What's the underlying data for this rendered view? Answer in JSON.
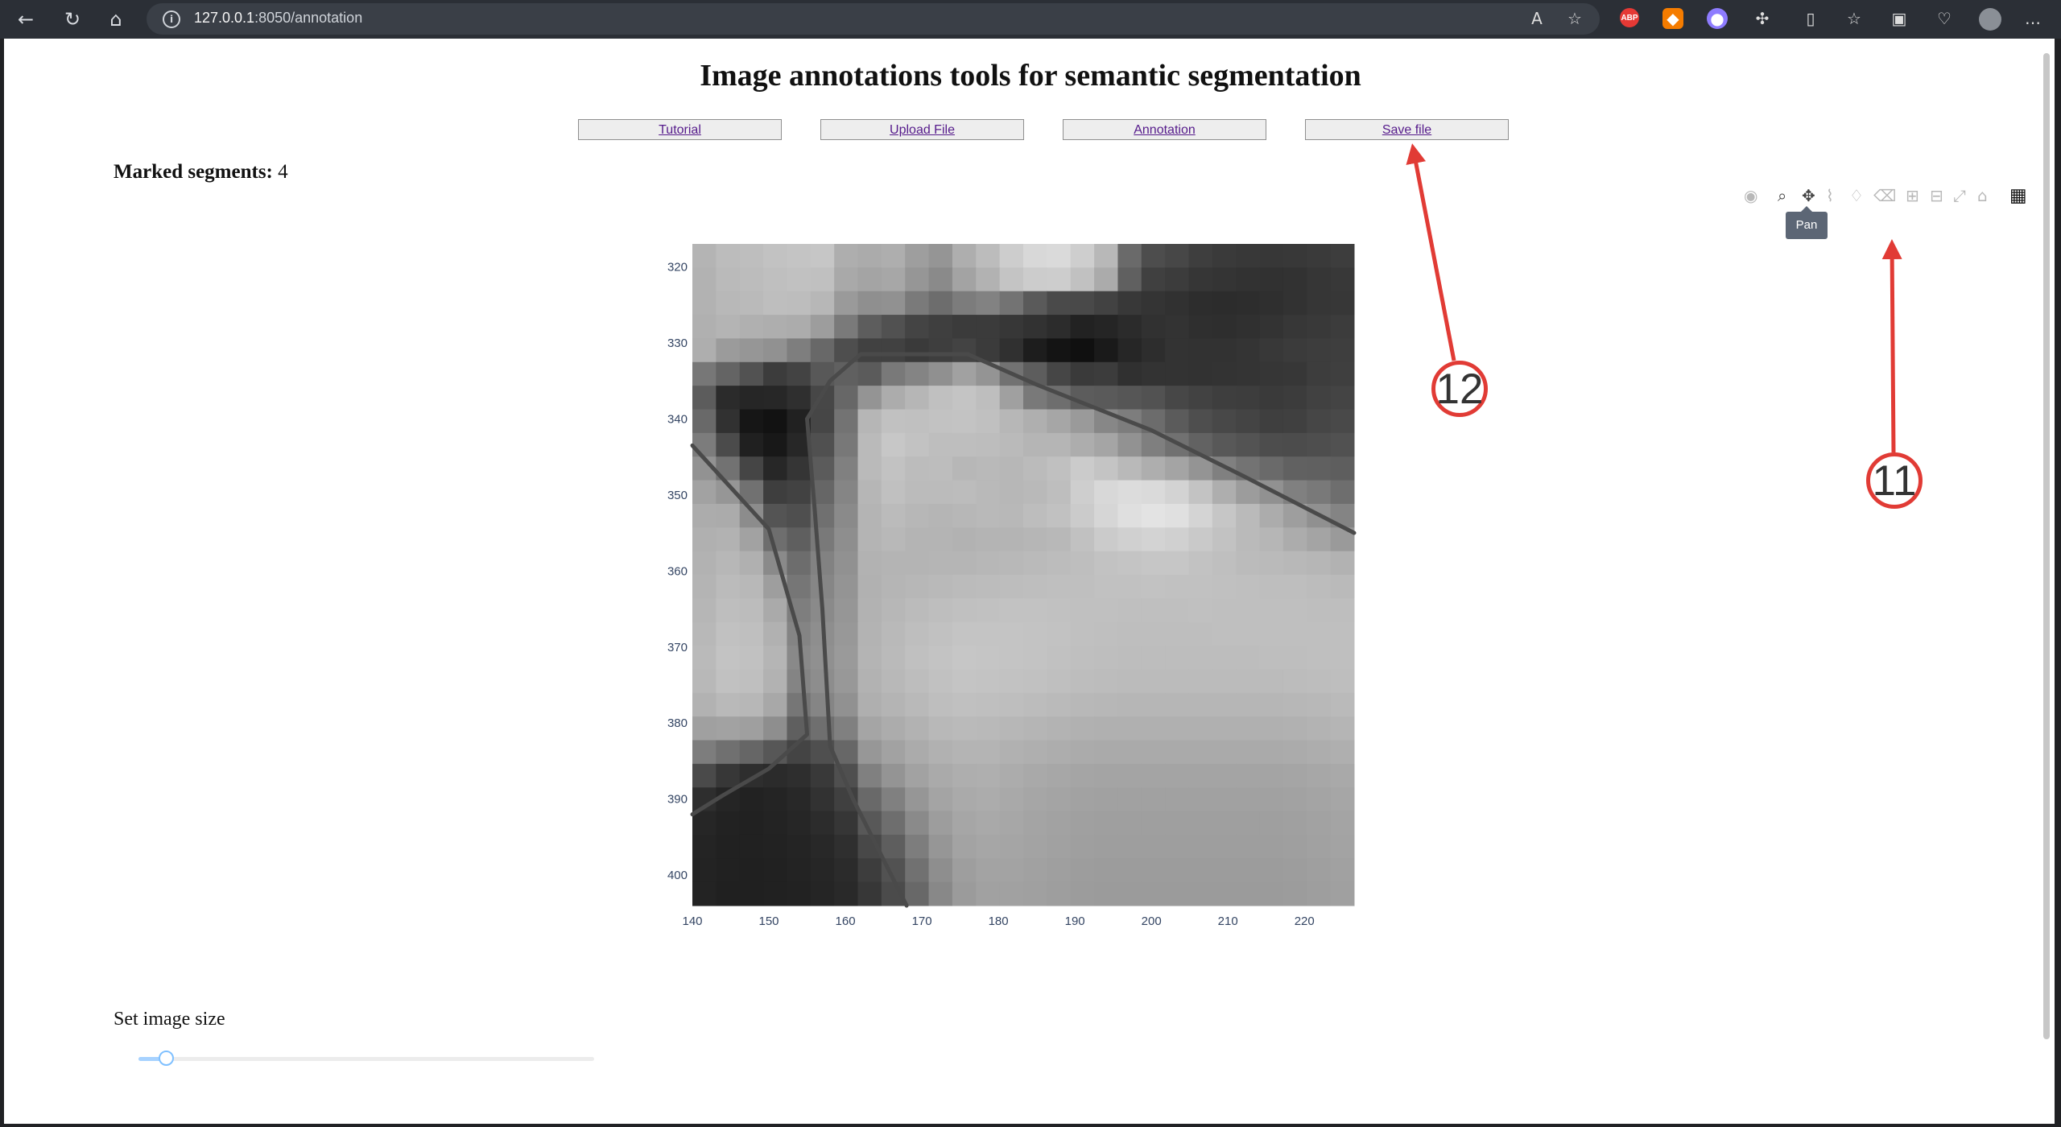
{
  "browser": {
    "url_prefix": "127.0.0.1",
    "url_suffix": ":8050/annotation",
    "icons": [
      "back-arrow-icon",
      "refresh-icon",
      "home-icon",
      "info-icon",
      "read-aloud-icon",
      "favorite-star-icon",
      "abp-extension-icon",
      "fox-extension-icon",
      "purple-extension-icon",
      "puzzle-extension-icon",
      "split-screen-icon",
      "favorites-icon",
      "collections-icon",
      "copilot-heart-icon",
      "profile-avatar-icon",
      "more-icon"
    ],
    "abp_label": "ABP"
  },
  "page": {
    "title": "Image annotations tools for semantic segmentation",
    "buttons": [
      "Tutorial",
      "Upload File",
      "Annotation",
      "Save file"
    ],
    "marked_segments_label": "Marked segments:",
    "marked_segments_value": "4",
    "tooltip": "Pan",
    "slider_label": "Set image size",
    "slider_fraction": 0.06
  },
  "chart_data": {
    "type": "heatmap",
    "x_ticks": [
      140,
      150,
      160,
      170,
      180,
      190,
      200,
      210,
      220
    ],
    "y_ticks": [
      320,
      330,
      340,
      350,
      360,
      370,
      380,
      390,
      400
    ],
    "x_range": [
      140,
      226.5
    ],
    "y_range": [
      317,
      404
    ],
    "pixels": [
      [
        180,
        188,
        190,
        194,
        196,
        198,
        174,
        171,
        174,
        158,
        149,
        174,
        188,
        205,
        216,
        218,
        206,
        184,
        106,
        77,
        71,
        62,
        58,
        56,
        55,
        56,
        58,
        61
      ],
      [
        178,
        186,
        188,
        191,
        193,
        192,
        169,
        164,
        167,
        150,
        138,
        163,
        178,
        196,
        204,
        205,
        193,
        171,
        96,
        64,
        60,
        54,
        52,
        50,
        49,
        50,
        54,
        56
      ],
      [
        178,
        184,
        186,
        190,
        189,
        183,
        154,
        143,
        145,
        122,
        109,
        124,
        130,
        115,
        90,
        74,
        73,
        66,
        56,
        52,
        49,
        45,
        44,
        45,
        47,
        50,
        54,
        55
      ],
      [
        176,
        180,
        176,
        174,
        172,
        157,
        122,
        93,
        81,
        68,
        63,
        59,
        59,
        55,
        50,
        44,
        34,
        37,
        43,
        49,
        51,
        47,
        46,
        48,
        51,
        55,
        57,
        60
      ],
      [
        174,
        155,
        150,
        145,
        126,
        104,
        78,
        65,
        65,
        58,
        62,
        67,
        59,
        48,
        29,
        20,
        16,
        26,
        38,
        45,
        51,
        50,
        50,
        52,
        56,
        59,
        61,
        62
      ],
      [
        119,
        100,
        82,
        60,
        67,
        88,
        96,
        91,
        121,
        132,
        144,
        161,
        148,
        114,
        93,
        70,
        58,
        60,
        48,
        51,
        51,
        50,
        51,
        52,
        54,
        55,
        61,
        63
      ],
      [
        92,
        43,
        38,
        39,
        47,
        71,
        103,
        148,
        172,
        182,
        192,
        196,
        190,
        160,
        121,
        110,
        92,
        90,
        86,
        82,
        71,
        66,
        62,
        61,
        58,
        60,
        65,
        68
      ],
      [
        105,
        49,
        22,
        18,
        33,
        70,
        115,
        182,
        193,
        192,
        194,
        195,
        192,
        183,
        175,
        166,
        154,
        135,
        125,
        108,
        91,
        78,
        72,
        68,
        63,
        64,
        70,
        73
      ],
      [
        124,
        75,
        32,
        24,
        39,
        80,
        120,
        186,
        199,
        194,
        190,
        190,
        189,
        186,
        181,
        181,
        173,
        165,
        146,
        127,
        113,
        98,
        88,
        83,
        77,
        76,
        78,
        81
      ],
      [
        146,
        114,
        69,
        39,
        53,
        91,
        128,
        186,
        194,
        188,
        189,
        183,
        185,
        183,
        187,
        192,
        203,
        196,
        185,
        174,
        164,
        148,
        128,
        115,
        106,
        97,
        96,
        94
      ],
      [
        162,
        150,
        113,
        62,
        66,
        102,
        133,
        182,
        192,
        187,
        187,
        188,
        185,
        183,
        185,
        190,
        206,
        216,
        220,
        218,
        211,
        195,
        174,
        156,
        145,
        128,
        121,
        110
      ],
      [
        172,
        171,
        140,
        84,
        79,
        112,
        138,
        180,
        187,
        183,
        181,
        183,
        185,
        184,
        189,
        193,
        203,
        214,
        223,
        227,
        224,
        212,
        198,
        186,
        172,
        158,
        144,
        132
      ],
      [
        176,
        178,
        162,
        110,
        95,
        121,
        142,
        180,
        184,
        180,
        180,
        178,
        180,
        180,
        182,
        184,
        193,
        203,
        208,
        211,
        208,
        201,
        194,
        186,
        182,
        172,
        164,
        154
      ],
      [
        178,
        183,
        176,
        138,
        109,
        130,
        145,
        178,
        180,
        180,
        181,
        181,
        183,
        184,
        186,
        188,
        190,
        194,
        196,
        198,
        198,
        194,
        191,
        187,
        186,
        184,
        182,
        178
      ],
      [
        180,
        187,
        184,
        158,
        118,
        134,
        148,
        177,
        181,
        183,
        185,
        187,
        188,
        189,
        190,
        191,
        191,
        193,
        193,
        194,
        193,
        193,
        192,
        191,
        190,
        190,
        188,
        186
      ],
      [
        182,
        190,
        188,
        170,
        126,
        138,
        150,
        178,
        183,
        187,
        190,
        192,
        193,
        194,
        194,
        193,
        192,
        192,
        191,
        191,
        191,
        192,
        191,
        191,
        191,
        191,
        190,
        190
      ],
      [
        184,
        193,
        191,
        177,
        132,
        142,
        152,
        179,
        185,
        190,
        193,
        196,
        196,
        196,
        195,
        194,
        192,
        191,
        190,
        190,
        190,
        190,
        191,
        191,
        191,
        191,
        191,
        191
      ],
      [
        186,
        195,
        193,
        181,
        137,
        144,
        154,
        180,
        186,
        192,
        195,
        198,
        197,
        196,
        195,
        193,
        191,
        190,
        189,
        189,
        189,
        189,
        189,
        189,
        190,
        190,
        191,
        191
      ],
      [
        184,
        193,
        191,
        178,
        132,
        141,
        152,
        178,
        184,
        189,
        193,
        196,
        195,
        194,
        193,
        191,
        189,
        188,
        187,
        187,
        187,
        187,
        187,
        187,
        187,
        188,
        189,
        190
      ],
      [
        178,
        185,
        183,
        168,
        118,
        133,
        145,
        175,
        180,
        185,
        190,
        192,
        191,
        190,
        188,
        186,
        184,
        183,
        182,
        182,
        182,
        182,
        182,
        182,
        182,
        183,
        184,
        186
      ],
      [
        160,
        162,
        159,
        142,
        95,
        111,
        128,
        165,
        172,
        178,
        184,
        186,
        185,
        183,
        181,
        179,
        177,
        176,
        176,
        176,
        176,
        176,
        176,
        176,
        176,
        177,
        179,
        181
      ],
      [
        125,
        112,
        102,
        87,
        68,
        79,
        103,
        151,
        162,
        171,
        177,
        180,
        180,
        177,
        175,
        173,
        171,
        170,
        170,
        170,
        170,
        170,
        170,
        170,
        170,
        171,
        173,
        175
      ],
      [
        74,
        55,
        46,
        43,
        46,
        57,
        79,
        128,
        148,
        162,
        170,
        174,
        175,
        172,
        169,
        167,
        165,
        164,
        164,
        164,
        164,
        164,
        164,
        164,
        164,
        165,
        167,
        169
      ],
      [
        46,
        37,
        34,
        36,
        40,
        50,
        64,
        105,
        128,
        150,
        164,
        170,
        172,
        169,
        166,
        164,
        162,
        161,
        161,
        161,
        161,
        161,
        161,
        161,
        161,
        162,
        164,
        166
      ],
      [
        38,
        34,
        33,
        35,
        38,
        44,
        54,
        88,
        110,
        138,
        157,
        166,
        169,
        167,
        164,
        162,
        160,
        159,
        159,
        159,
        159,
        159,
        159,
        159,
        159,
        160,
        162,
        164
      ],
      [
        36,
        33,
        33,
        34,
        36,
        40,
        47,
        72,
        94,
        125,
        150,
        163,
        166,
        165,
        163,
        161,
        159,
        158,
        158,
        158,
        158,
        158,
        158,
        158,
        158,
        159,
        161,
        163
      ],
      [
        35,
        33,
        32,
        33,
        35,
        38,
        43,
        61,
        82,
        113,
        142,
        158,
        163,
        163,
        161,
        159,
        157,
        156,
        156,
        156,
        156,
        156,
        156,
        156,
        156,
        157,
        159,
        161
      ],
      [
        35,
        32,
        32,
        33,
        34,
        37,
        41,
        55,
        75,
        104,
        136,
        155,
        161,
        161,
        160,
        158,
        156,
        155,
        155,
        155,
        155,
        155,
        155,
        155,
        155,
        156,
        158,
        160
      ]
    ],
    "segments": [
      {
        "points": [
          [
            140,
            343.5
          ],
          [
            150,
            354.5
          ],
          [
            154,
            368.5
          ],
          [
            155,
            381.5
          ],
          [
            150,
            386
          ],
          [
            144,
            389.5
          ],
          [
            140,
            392
          ]
        ]
      },
      {
        "points": [
          [
            155,
            340
          ],
          [
            158,
            335
          ],
          [
            162,
            331.5
          ],
          [
            176,
            331.5
          ],
          [
            185,
            335.5
          ],
          [
            200,
            341.5
          ],
          [
            212,
            347.5
          ],
          [
            226.5,
            355
          ]
        ]
      },
      {
        "points": [
          [
            155,
            340
          ],
          [
            156,
            352
          ],
          [
            157,
            365
          ],
          [
            158,
            383
          ],
          [
            161,
            390
          ],
          [
            165,
            398
          ],
          [
            168,
            404
          ]
        ]
      }
    ],
    "segment_color": "#4a4a4a",
    "colorscale": "gray"
  },
  "annotations": [
    {
      "label": "12",
      "target": "save-file-button"
    },
    {
      "label": "11",
      "target": "modebar-plotly-logo"
    }
  ]
}
